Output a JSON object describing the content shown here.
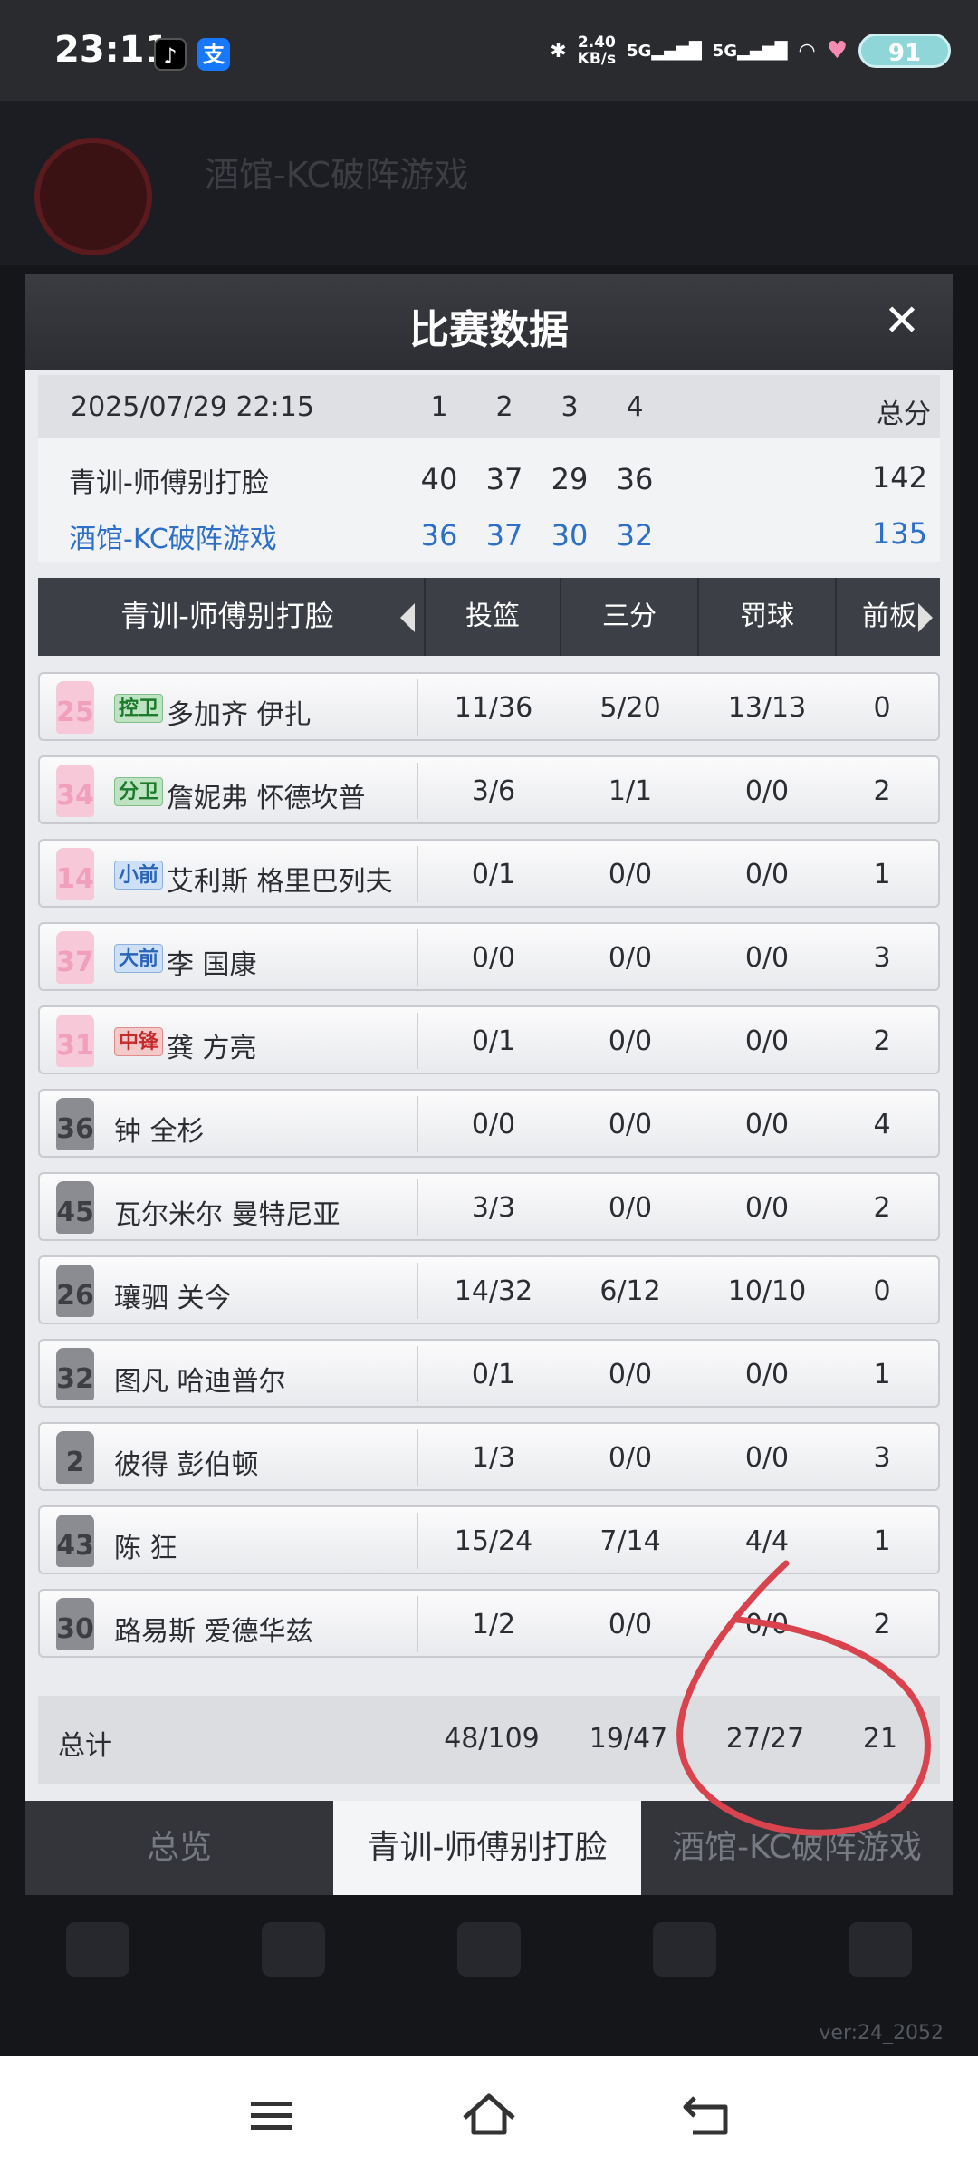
{
  "status_bar": {
    "time": "23:11",
    "net_speed_value": "2.40",
    "net_speed_unit": "KB/s",
    "signal1": "5G",
    "signal2": "5G",
    "battery": "91"
  },
  "background": {
    "team_name": "酒馆-KC破阵游戏",
    "version": "ver:24_2052"
  },
  "modal": {
    "title": "比赛数据",
    "close_label": "✕"
  },
  "scoreboard": {
    "date": "2025/07/29 22:15",
    "quarters": [
      "1",
      "2",
      "3",
      "4"
    ],
    "total_label": "总分",
    "teams": [
      {
        "name": "青训-师傅别打脸",
        "scores": [
          "40",
          "37",
          "29",
          "36"
        ],
        "total": "142"
      },
      {
        "name": "酒馆-KC破阵游戏",
        "scores": [
          "36",
          "37",
          "30",
          "32"
        ],
        "total": "135"
      }
    ]
  },
  "stats_header": {
    "team": "青训-师傅别打脸",
    "columns": [
      "投篮",
      "三分",
      "罚球",
      "前板"
    ]
  },
  "players": [
    {
      "number": "25",
      "jersey": "pink",
      "position": "控卫",
      "pos_type": "g",
      "name": "多加齐 伊扎",
      "fg": "11/36",
      "three": "5/20",
      "ft": "13/13",
      "oreb": "0"
    },
    {
      "number": "34",
      "jersey": "pink",
      "position": "分卫",
      "pos_type": "g",
      "name": "詹妮弗 怀德坎普",
      "fg": "3/6",
      "three": "1/1",
      "ft": "0/0",
      "oreb": "2"
    },
    {
      "number": "14",
      "jersey": "pink",
      "position": "小前",
      "pos_type": "f",
      "name": "艾利斯 格里巴列夫",
      "fg": "0/1",
      "three": "0/0",
      "ft": "0/0",
      "oreb": "1"
    },
    {
      "number": "37",
      "jersey": "pink",
      "position": "大前",
      "pos_type": "f",
      "name": "李 国康",
      "fg": "0/0",
      "three": "0/0",
      "ft": "0/0",
      "oreb": "3"
    },
    {
      "number": "31",
      "jersey": "pink",
      "position": "中锋",
      "pos_type": "c",
      "name": "龚 方亮",
      "fg": "0/1",
      "three": "0/0",
      "ft": "0/0",
      "oreb": "2"
    },
    {
      "number": "36",
      "jersey": "gray",
      "position": "",
      "pos_type": "",
      "name": "钟 全杉",
      "fg": "0/0",
      "three": "0/0",
      "ft": "0/0",
      "oreb": "4"
    },
    {
      "number": "45",
      "jersey": "gray",
      "position": "",
      "pos_type": "",
      "name": "瓦尔米尔 曼特尼亚",
      "fg": "3/3",
      "three": "0/0",
      "ft": "0/0",
      "oreb": "2"
    },
    {
      "number": "26",
      "jersey": "gray",
      "position": "",
      "pos_type": "",
      "name": "瓖驷 关今",
      "fg": "14/32",
      "three": "6/12",
      "ft": "10/10",
      "oreb": "0"
    },
    {
      "number": "32",
      "jersey": "gray",
      "position": "",
      "pos_type": "",
      "name": "图凡 哈迪普尔",
      "fg": "0/1",
      "three": "0/0",
      "ft": "0/0",
      "oreb": "1"
    },
    {
      "number": "2",
      "jersey": "gray",
      "position": "",
      "pos_type": "",
      "name": "彼得 彭伯顿",
      "fg": "1/3",
      "three": "0/0",
      "ft": "0/0",
      "oreb": "3"
    },
    {
      "number": "43",
      "jersey": "gray",
      "position": "",
      "pos_type": "",
      "name": "陈 狂",
      "fg": "15/24",
      "three": "7/14",
      "ft": "4/4",
      "oreb": "1"
    },
    {
      "number": "30",
      "jersey": "gray",
      "position": "",
      "pos_type": "",
      "name": "路易斯 爱德华兹",
      "fg": "1/2",
      "three": "0/0",
      "ft": "0/0",
      "oreb": "2"
    }
  ],
  "totals": {
    "label": "总计",
    "fg": "48/109",
    "three": "19/47",
    "ft": "27/27",
    "oreb": "21"
  },
  "tabs": [
    "总览",
    "青训-师傅别打脸",
    "酒馆-KC破阵游戏"
  ],
  "active_tab": 1,
  "colors": {
    "annotation": "#d9434e",
    "team2": "#2e6fc7"
  }
}
